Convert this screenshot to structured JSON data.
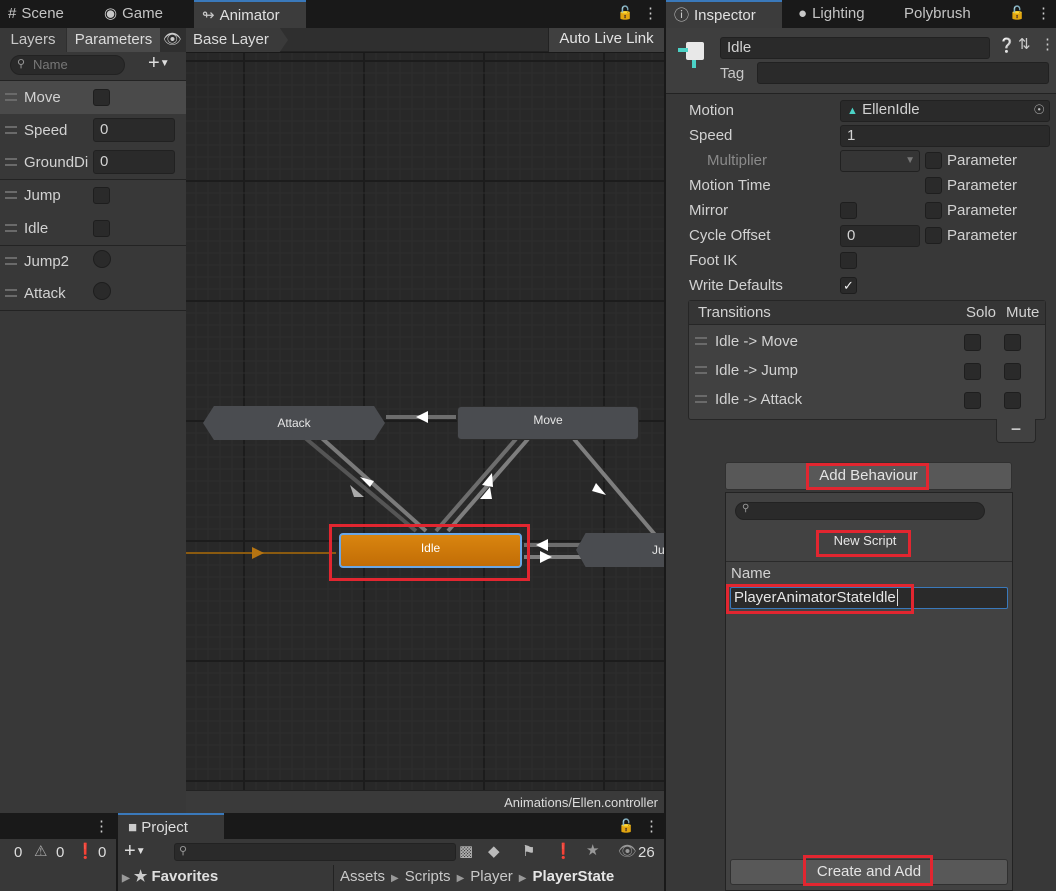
{
  "left_tabs": {
    "scene": "Scene",
    "game": "Game",
    "animator": "Animator"
  },
  "animator": {
    "layers_tab": "Layers",
    "params_tab": "Parameters",
    "search_placeholder": "Name",
    "breadcrumb": "Base Layer",
    "auto_live_link": "Auto Live Link",
    "footer_path": "Animations/Ellen.controller",
    "params": [
      {
        "name": "Move",
        "type": "bool",
        "value": ""
      },
      {
        "name": "Speed",
        "type": "float",
        "value": "0"
      },
      {
        "name": "GroundDi",
        "type": "float",
        "value": "0"
      },
      {
        "name": "Jump",
        "type": "bool",
        "value": ""
      },
      {
        "name": "Idle",
        "type": "bool",
        "value": ""
      },
      {
        "name": "Jump2",
        "type": "trigger",
        "value": ""
      },
      {
        "name": "Attack",
        "type": "trigger",
        "value": ""
      }
    ],
    "states": {
      "attack": "Attack",
      "move": "Move",
      "idle": "Idle",
      "jump": "Ju"
    }
  },
  "console": {
    "errors": "0",
    "warnings": "0",
    "messages": "0"
  },
  "project": {
    "tab": "Project",
    "count": "26",
    "favorites": "Favorites",
    "breadcrumbs": [
      "Assets",
      "Scripts",
      "Player",
      "PlayerState"
    ]
  },
  "right_tabs": {
    "inspector": "Inspector",
    "lighting": "Lighting",
    "polybrush": "Polybrush"
  },
  "inspector": {
    "name": "Idle",
    "tag_label": "Tag",
    "tag_value": "",
    "motion_label": "Motion",
    "motion_value": "EllenIdle",
    "speed_label": "Speed",
    "speed_value": "1",
    "multiplier_label": "Multiplier",
    "motion_time_label": "Motion Time",
    "mirror_label": "Mirror",
    "cycle_offset_label": "Cycle Offset",
    "cycle_offset_value": "0",
    "foot_ik_label": "Foot IK",
    "write_defaults_label": "Write Defaults",
    "parameter_label": "Parameter",
    "transitions_header": "Transitions",
    "solo": "Solo",
    "mute": "Mute",
    "transitions": [
      "Idle -> Move",
      "Idle -> Jump",
      "Idle -> Attack"
    ],
    "minus": "−",
    "add_behaviour": "Add Behaviour",
    "new_script": "New Script",
    "name_label": "Name",
    "script_name": "PlayerAnimatorStateIdle",
    "create_and_add": "Create and Add"
  }
}
